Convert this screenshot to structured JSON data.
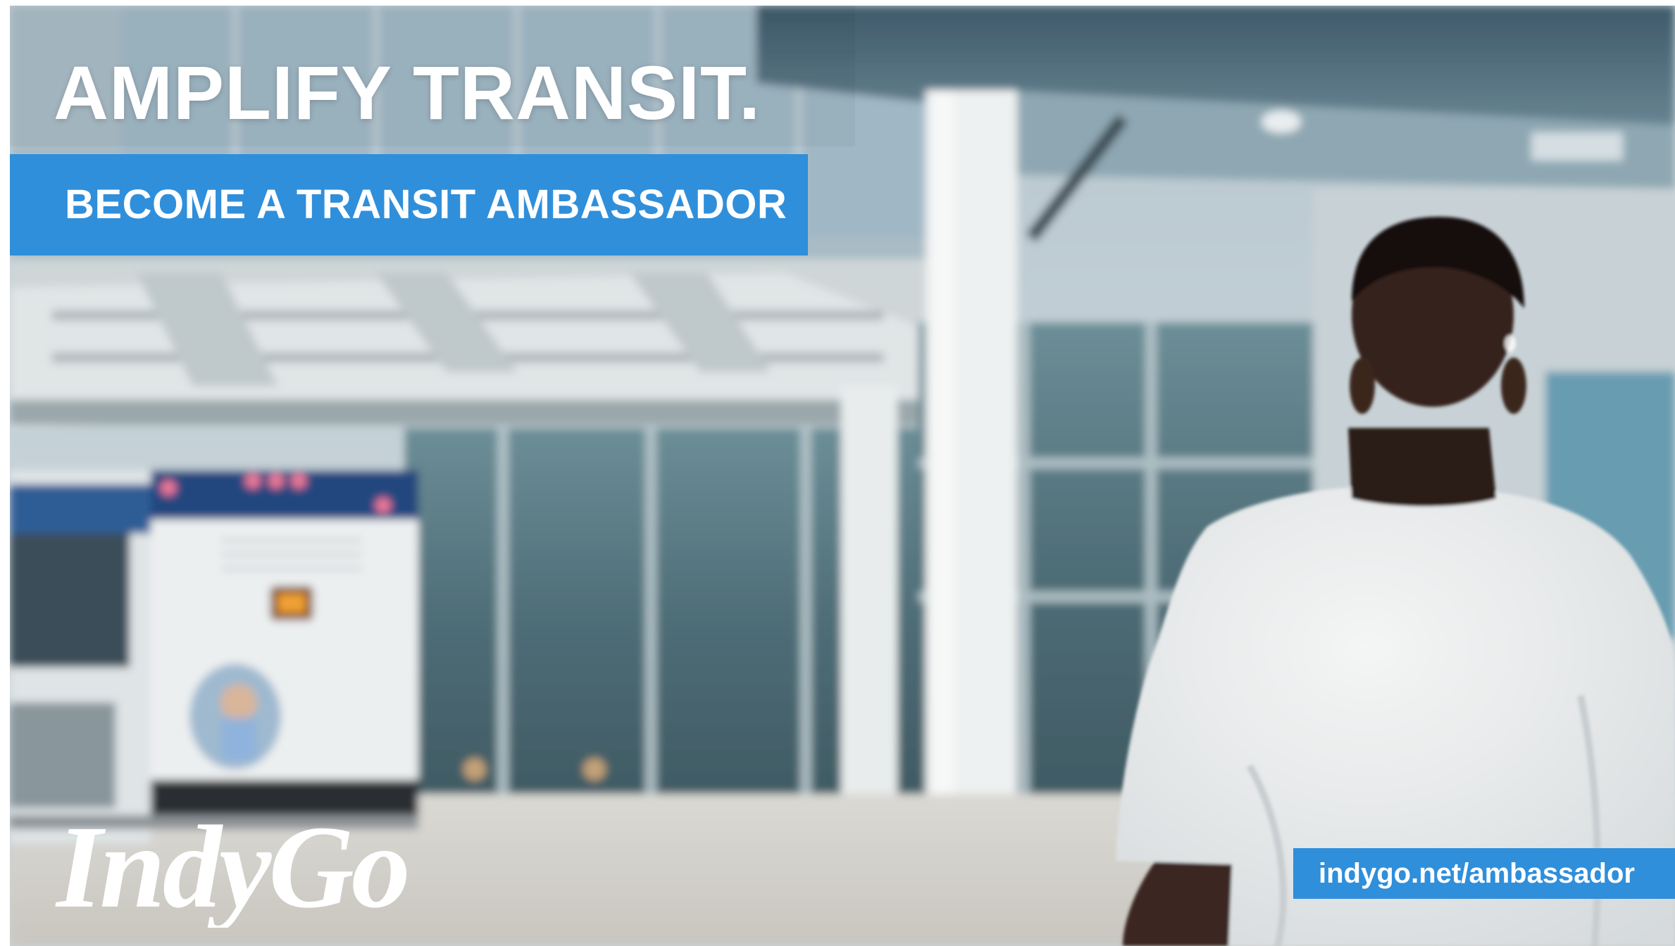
{
  "ad": {
    "headline": "AMPLIFY TRANSIT.",
    "banner": "BECOME A TRANSIT AMBASSADOR",
    "logo_text": "IndyGo",
    "url": "indygo.net/ambassador"
  },
  "colors": {
    "accent_blue": "#2f8fdb",
    "text": "#ffffff"
  },
  "scene": {
    "description_icons": [
      "bus-icon",
      "transit-station",
      "person-white-tshirt"
    ]
  }
}
